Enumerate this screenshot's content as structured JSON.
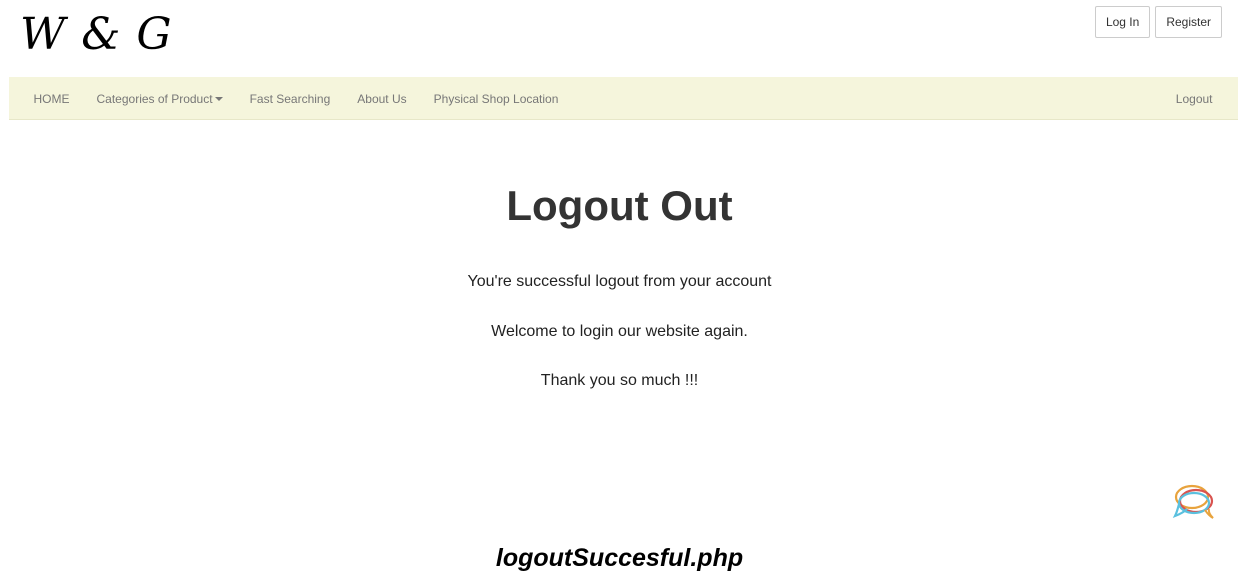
{
  "logo": {
    "text": "W & G"
  },
  "auth": {
    "login_label": "Log In",
    "register_label": "Register"
  },
  "nav": {
    "items": [
      {
        "label": "HOME"
      },
      {
        "label": "Categories of Product"
      },
      {
        "label": "Fast Searching"
      },
      {
        "label": "About Us"
      },
      {
        "label": "Physical Shop Location"
      }
    ],
    "logout_label": "Logout"
  },
  "main": {
    "title": "Logout Out",
    "messages": [
      "You're successful logout from your account",
      "Welcome to login our website again.",
      "Thank you so much !!!"
    ]
  },
  "caption": "logoutSuccesful.php",
  "icons": {
    "chat": "chat-bubbles-icon"
  },
  "colors": {
    "navbar_bg": "#f5f5dc",
    "text": "#333333",
    "nav_text": "#777777"
  }
}
